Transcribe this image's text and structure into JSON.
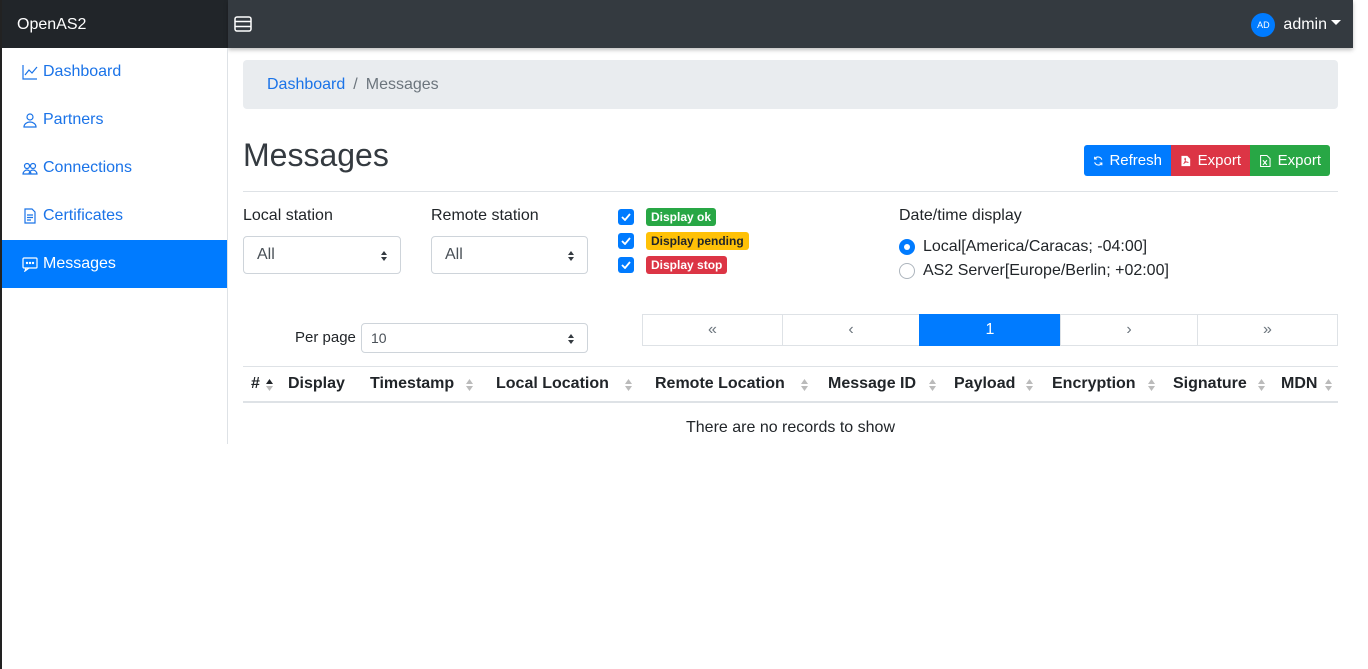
{
  "brand": "OpenAS2",
  "user": {
    "initials": "AD",
    "name": "admin"
  },
  "sidebar": {
    "items": [
      {
        "label": "Dashboard",
        "icon": "chart-line-icon"
      },
      {
        "label": "Partners",
        "icon": "user-icon"
      },
      {
        "label": "Connections",
        "icon": "users-icon"
      },
      {
        "label": "Certificates",
        "icon": "document-icon"
      },
      {
        "label": "Messages",
        "icon": "message-icon",
        "active": true
      }
    ]
  },
  "breadcrumb": {
    "home": "Dashboard",
    "sep": "/",
    "current": "Messages"
  },
  "page": {
    "title": "Messages"
  },
  "toolbar": {
    "refresh": "Refresh",
    "export_pdf": "Export",
    "export_xls": "Export"
  },
  "filters": {
    "local_station_label": "Local station",
    "local_station_value": "All",
    "remote_station_label": "Remote station",
    "remote_station_value": "All",
    "display_ok": "Display ok",
    "display_pending": "Display pending",
    "display_stop": "Display stop",
    "datetime_label": "Date/time display",
    "tz_local": "Local[America/Caracas; -04:00]",
    "tz_server": "AS2 Server[Europe/Berlin; +02:00]",
    "per_page_label": "Per page",
    "per_page_value": "10"
  },
  "pager": {
    "first": "«",
    "prev": "‹",
    "current": "1",
    "next": "›",
    "last": "»"
  },
  "table": {
    "columns": [
      "#",
      "Display",
      "Timestamp",
      "Local Location",
      "Remote Location",
      "Message ID",
      "Payload",
      "Encryption",
      "Signature",
      "MDN"
    ],
    "empty": "There are no records to show"
  },
  "colors": {
    "primary": "#007bff",
    "danger": "#dc3545",
    "success": "#28a745",
    "warning": "#ffc107",
    "dark": "#343a40"
  }
}
